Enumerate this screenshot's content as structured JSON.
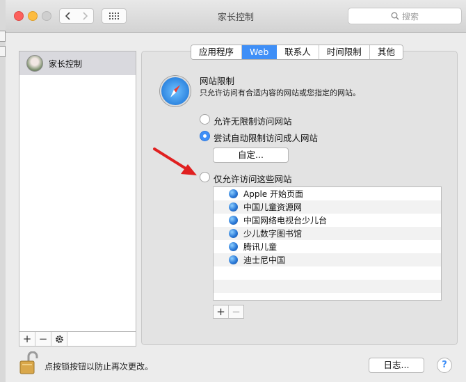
{
  "window": {
    "title": "家长控制",
    "search_placeholder": "搜索"
  },
  "sidebar": {
    "items": [
      {
        "label": "家长控制"
      }
    ]
  },
  "tabs": [
    "应用程序",
    "Web",
    "联系人",
    "时间限制",
    "其他"
  ],
  "active_tab": "Web",
  "web": {
    "title": "网站限制",
    "description": "只允许访问有合适内容的网站或您指定的网站。",
    "options": [
      {
        "label": "允许无限制访问网站",
        "selected": false
      },
      {
        "label": "尝试自动限制访问成人网站",
        "selected": true
      },
      {
        "label": "仅允许访问这些网站",
        "selected": false
      }
    ],
    "customize_label": "自定...",
    "sites": [
      "Apple 开始页面",
      "中国儿童资源网",
      "中国网络电视台少儿台",
      "少儿数字图书馆",
      "腾讯儿童",
      "迪士尼中国"
    ]
  },
  "footer": {
    "lock_text": "点按锁按钮以防止再次更改。",
    "log_button": "日志...",
    "help": "?"
  },
  "colors": {
    "accent": "#3f8ff7",
    "arrow": "#e02020"
  }
}
